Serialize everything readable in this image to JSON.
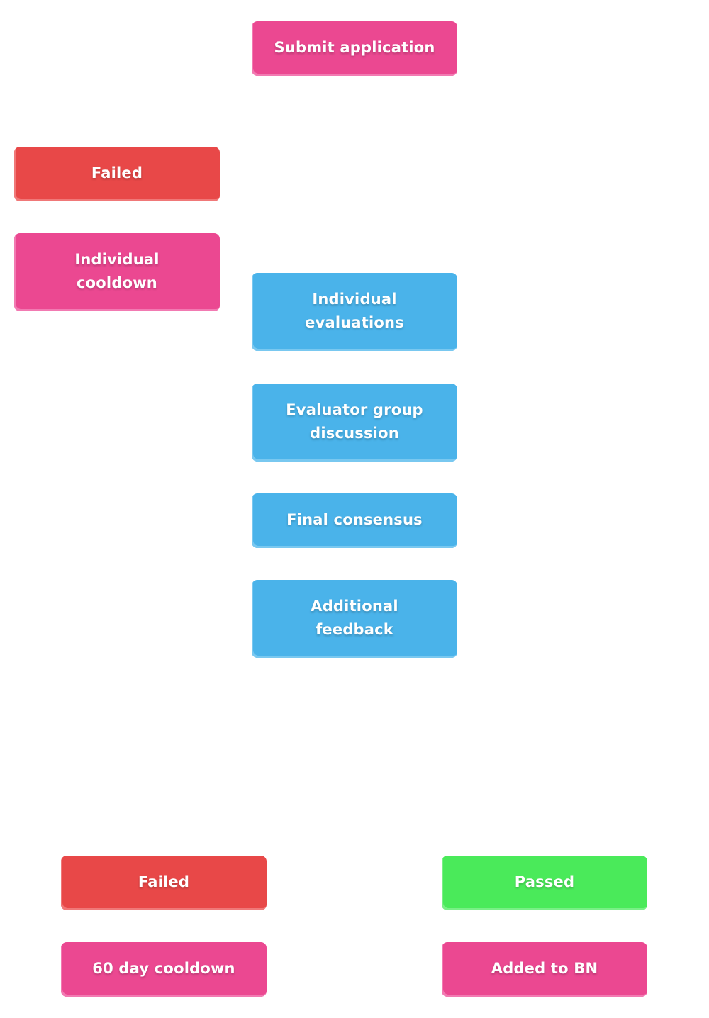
{
  "diagram": {
    "type": "flowchart",
    "colors": {
      "pink": "#EB4891",
      "red": "#E84848",
      "blue": "#4AB3EA",
      "green": "#4AEA5A"
    },
    "nodes": {
      "submit_application": {
        "label": "Submit application",
        "color": "pink"
      },
      "failed_initial": {
        "label": "Failed",
        "color": "red"
      },
      "individual_cooldown": {
        "label": "Individual\ncooldown",
        "color": "pink"
      },
      "individual_evaluations": {
        "label": "Individual\nevaluations",
        "color": "blue"
      },
      "evaluator_group_discussion": {
        "label": "Evaluator group\ndiscussion",
        "color": "blue"
      },
      "final_consensus": {
        "label": "Final consensus",
        "color": "blue"
      },
      "additional_feedback": {
        "label": "Additional\nfeedback",
        "color": "blue"
      },
      "failed_final": {
        "label": "Failed",
        "color": "red"
      },
      "sixty_day_cooldown": {
        "label": "60 day cooldown",
        "color": "pink"
      },
      "passed": {
        "label": "Passed",
        "color": "green"
      },
      "added_to_bn": {
        "label": "Added to BN",
        "color": "pink"
      }
    }
  }
}
